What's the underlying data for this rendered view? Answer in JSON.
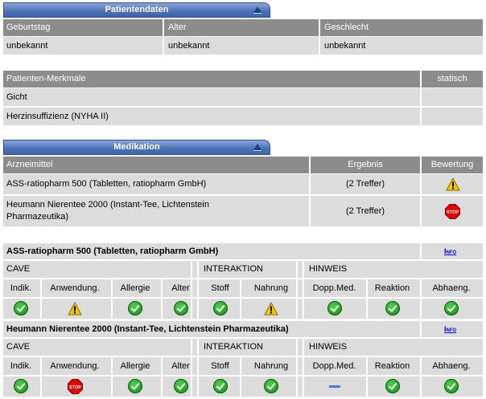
{
  "patient": {
    "banner": "Patientendaten",
    "headers": [
      "Geburtstag",
      "Alter",
      "Geschlecht"
    ],
    "values": [
      "unbekannt",
      "unbekannt",
      "unbekannt"
    ]
  },
  "merkmale": {
    "header": "Patienten-Merkmale",
    "header_right": "statisch",
    "rows": [
      "Gicht",
      "Herzinsuffizienz (NYHA II)"
    ]
  },
  "medikation": {
    "banner": "Medikation",
    "headers": [
      "Arzneimittel",
      "Ergebnis",
      "Bewertung"
    ],
    "rows": [
      {
        "name": "ASS-ratiopharm 500 (Tabletten, ratiopharm GmbH)",
        "result": "(2 Treffer)",
        "rating": "warning-icon"
      },
      {
        "name_line1": "Heumann Nierentee 2000 (Instant-Tee, Lichtenstein",
        "name_line2": "Pharmazeutika)",
        "result": "(2 Treffer)",
        "rating": "stop-icon"
      }
    ]
  },
  "details": {
    "info_label": "Info",
    "group_labels": [
      "CAVE",
      "INTERAKTION",
      "HINWEIS"
    ],
    "columns": [
      "Indik.",
      "Anwendung.",
      "Allergie",
      "Alter",
      "Stoff",
      "Nahrung",
      "Dopp.Med.",
      "Reaktion",
      "Abhaeng."
    ],
    "drugs": [
      {
        "title": "ASS-ratiopharm 500 (Tabletten, ratiopharm GmbH)",
        "statuses": [
          "check",
          "warning",
          "check",
          "check",
          "check",
          "warning",
          "check",
          "check",
          "check"
        ]
      },
      {
        "title": "Heumann Nierentee 2000 (Instant-Tee, Lichtenstein Pharmazeutika)",
        "statuses": [
          "check",
          "stop",
          "check",
          "check",
          "check",
          "check",
          "none",
          "check",
          "check"
        ]
      }
    ]
  },
  "colors": {
    "banner": "#4b71b6",
    "header": "#8c8c8c",
    "row": "#dcdcdc",
    "check": "#1a9a1a",
    "warning": "#f2c400",
    "stop": "#e00000",
    "link": "#0000cc"
  }
}
